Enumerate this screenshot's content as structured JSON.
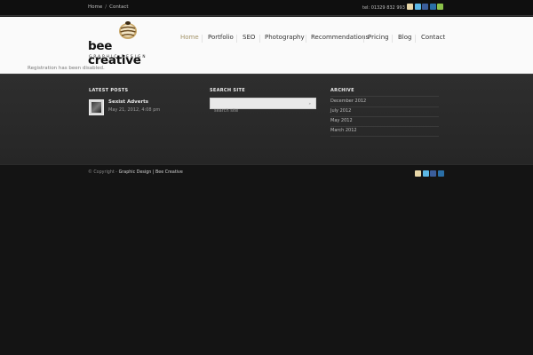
{
  "topbar": {
    "breadcrumbs": [
      "Home",
      "Contact"
    ],
    "separator": "/",
    "tel": "tel: 01329 832 993",
    "social_icons": [
      "home-icon",
      "twitter-icon",
      "facebook-icon",
      "linkedin-icon",
      "rss-icon"
    ]
  },
  "header": {
    "logo_title": "bee creative",
    "logo_subtitle": "GRAPHIC DESIGN",
    "nav": [
      {
        "label": "Home",
        "active": true
      },
      {
        "label": "Portfolio"
      },
      {
        "label": "SEO"
      },
      {
        "label": "Photography"
      },
      {
        "label": "Recommendations"
      },
      {
        "label": "Pricing"
      },
      {
        "label": "Blog"
      },
      {
        "label": "Contact"
      }
    ]
  },
  "notice": "Registration has been disabled.",
  "widgets": {
    "latest_posts": {
      "title": "LATEST POSTS",
      "post_title": "Sexist Adverts",
      "post_date": "May 21, 2012, 4:08 pm"
    },
    "search": {
      "title": "SEARCH SITE",
      "placeholder": "search site",
      "button": "»"
    },
    "archive": {
      "title": "ARCHIVE",
      "items": [
        "December 2012",
        "July 2012",
        "May 2012",
        "March 2012"
      ]
    }
  },
  "footer": {
    "copyright_prefix": "© Copyright -",
    "copyright_link": "Graphic Design | Bee Creative"
  },
  "colors": {
    "accent": "#a29267",
    "footer_bg": "#2b2b2b"
  }
}
